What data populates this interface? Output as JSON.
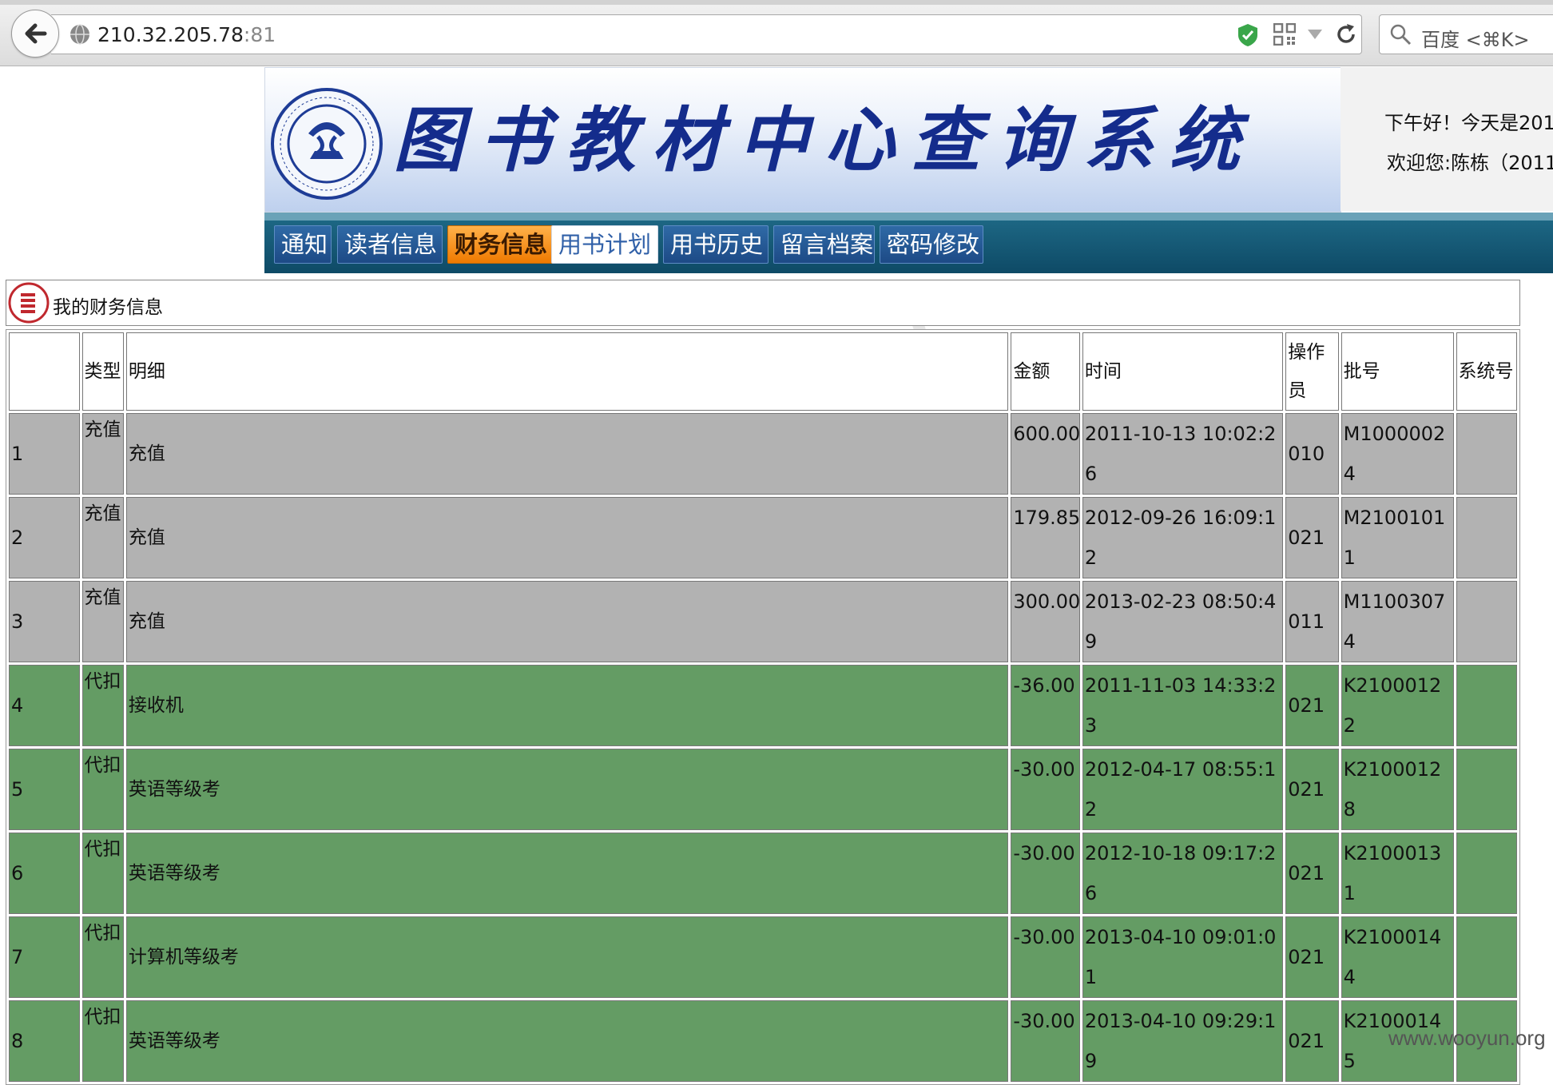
{
  "browser": {
    "url_host": "210.32.205.78",
    "url_port": ":81",
    "search_placeholder": "百度 <⌘K>"
  },
  "header": {
    "title": "图书教材中心查询系统",
    "greeting_line1": "下午好！今天是201",
    "greeting_line2": "欢迎您:陈栋（2011"
  },
  "nav": {
    "tabs": [
      {
        "label": "通知"
      },
      {
        "label": "读者信息"
      },
      {
        "label": "财务信息"
      },
      {
        "label": "用书计划"
      },
      {
        "label": "用书历史"
      },
      {
        "label": "留言档案"
      },
      {
        "label": "密码修改"
      }
    ]
  },
  "section": {
    "title": "我的财务信息"
  },
  "table": {
    "headers": {
      "type": "类型",
      "detail": "明细",
      "amount": "金额",
      "time": "时间",
      "operator": "操作员",
      "batch": "批号",
      "sysno": "系统号"
    },
    "rows": [
      {
        "no": "1",
        "type": "充值",
        "detail": "充值",
        "amount": "600.00",
        "time": "2011-10-13 10:02:26",
        "operator": "010",
        "batch": "M10000024",
        "sysno": ""
      },
      {
        "no": "2",
        "type": "充值",
        "detail": "充值",
        "amount": "179.85",
        "time": "2012-09-26 16:09:12",
        "operator": "021",
        "batch": "M21001011",
        "sysno": ""
      },
      {
        "no": "3",
        "type": "充值",
        "detail": "充值",
        "amount": "300.00",
        "time": "2013-02-23 08:50:49",
        "operator": "011",
        "batch": "M11003074",
        "sysno": ""
      },
      {
        "no": "4",
        "type": "代扣",
        "detail": "接收机",
        "amount": "-36.00",
        "time": "2011-11-03 14:33:23",
        "operator": "021",
        "batch": "K21000122",
        "sysno": ""
      },
      {
        "no": "5",
        "type": "代扣",
        "detail": "英语等级考",
        "amount": "-30.00",
        "time": "2012-04-17 08:55:12",
        "operator": "021",
        "batch": "K21000128",
        "sysno": ""
      },
      {
        "no": "6",
        "type": "代扣",
        "detail": "英语等级考",
        "amount": "-30.00",
        "time": "2012-10-18 09:17:26",
        "operator": "021",
        "batch": "K21000131",
        "sysno": ""
      },
      {
        "no": "7",
        "type": "代扣",
        "detail": "计算机等级考",
        "amount": "-30.00",
        "time": "2013-04-10 09:01:01",
        "operator": "021",
        "batch": "K21000144",
        "sysno": ""
      },
      {
        "no": "8",
        "type": "代扣",
        "detail": "英语等级考",
        "amount": "-30.00",
        "time": "2013-04-10 09:29:19",
        "operator": "021",
        "batch": "K21000145",
        "sysno": ""
      }
    ]
  },
  "footer": {
    "site_watermark": "www.wooyun.org"
  },
  "colors": {
    "recharge_row": "#b2b2b2",
    "deduct_row": "#649c64",
    "nav_active": "#ef7a00",
    "title_blue": "#142c8c"
  },
  "icons": [
    "back-arrow-icon",
    "globe-icon",
    "shield-check-icon",
    "qr-code-icon",
    "dropdown-icon",
    "reload-icon",
    "search-icon",
    "university-seal-icon",
    "list-icon"
  ]
}
